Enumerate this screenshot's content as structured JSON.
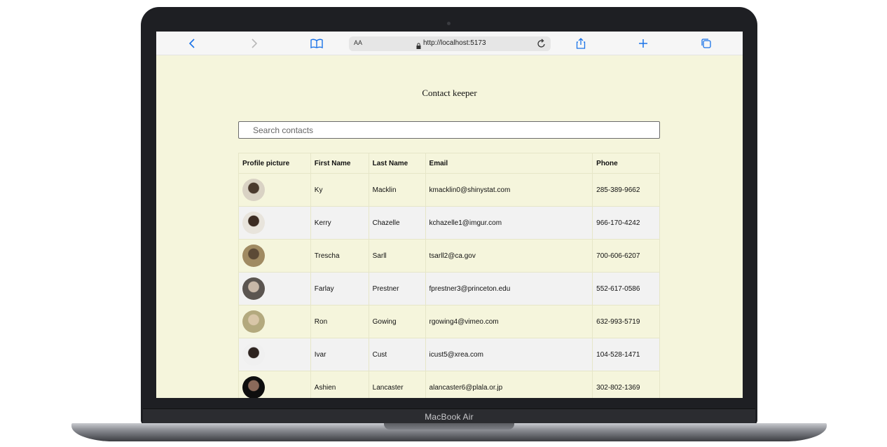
{
  "device": {
    "label": "MacBook Air"
  },
  "browser": {
    "text_size_label": "AA",
    "url": "http://localhost:5173",
    "icons": [
      "back-icon",
      "forward-icon",
      "bookmarks-icon",
      "lock-icon",
      "reload-icon",
      "share-icon",
      "new-tab-icon",
      "tabs-icon"
    ]
  },
  "page": {
    "title": "Contact keeper",
    "search": {
      "placeholder": "Search contacts",
      "value": ""
    }
  },
  "table": {
    "headers": [
      "Profile picture",
      "First Name",
      "Last Name",
      "Email",
      "Phone"
    ],
    "rows": [
      {
        "avatar_colors": [
          "#d9d2c4",
          "#4a3a2e"
        ],
        "first": "Ky",
        "last": "Macklin",
        "email": "kmacklin0@shinystat.com",
        "phone": "285-389-9662"
      },
      {
        "avatar_colors": [
          "#e8e4dc",
          "#3c2c22"
        ],
        "first": "Kerry",
        "last": "Chazelle",
        "email": "kchazelle1@imgur.com",
        "phone": "966-170-4242"
      },
      {
        "avatar_colors": [
          "#a08a62",
          "#5c4a36"
        ],
        "first": "Trescha",
        "last": "Sarll",
        "email": "tsarll2@ca.gov",
        "phone": "700-606-6207"
      },
      {
        "avatar_colors": [
          "#5b5550",
          "#c8b8a8"
        ],
        "first": "Farlay",
        "last": "Prestner",
        "email": "fprestner3@princeton.edu",
        "phone": "552-617-0586"
      },
      {
        "avatar_colors": [
          "#b3a97e",
          "#d8c6a8"
        ],
        "first": "Ron",
        "last": "Gowing",
        "email": "rgowing4@vimeo.com",
        "phone": "632-993-5719"
      },
      {
        "avatar_colors": [
          "#f0f0f0",
          "#2e2420"
        ],
        "first": "Ivar",
        "last": "Cust",
        "email": "icust5@xrea.com",
        "phone": "104-528-1471"
      },
      {
        "avatar_colors": [
          "#0e0e0e",
          "#8a6a5a"
        ],
        "first": "Ashien",
        "last": "Lancaster",
        "email": "alancaster6@plala.or.jp",
        "phone": "302-802-1369"
      }
    ]
  },
  "colors": {
    "page_bg": "#f5f5dc",
    "stripe_bg": "#f2f2f2",
    "accent": "#1a73e8"
  }
}
